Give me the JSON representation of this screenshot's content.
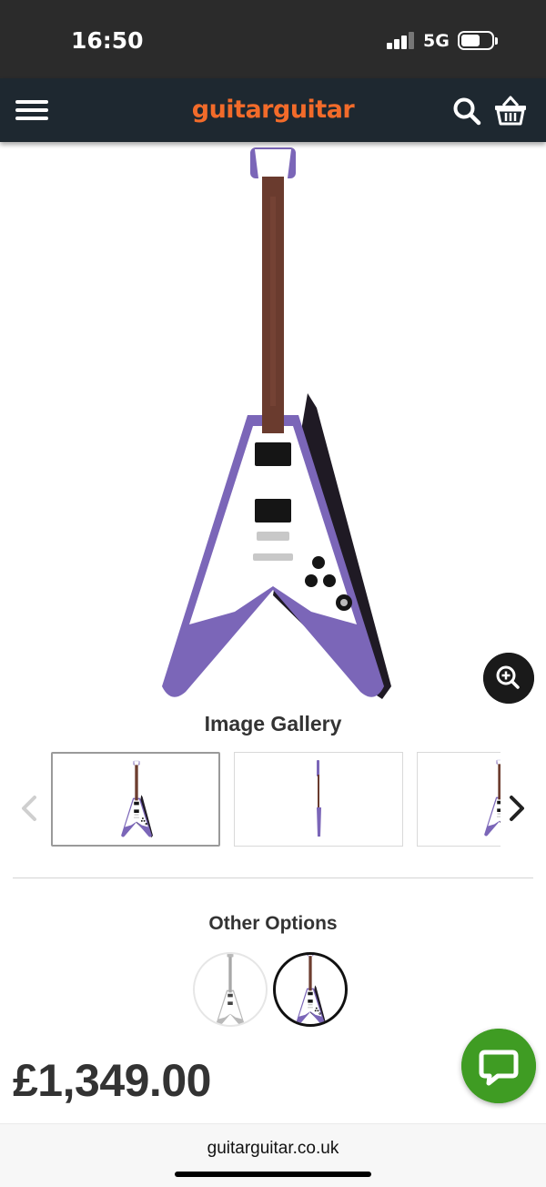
{
  "status_bar": {
    "time": "16:50",
    "network": "5G"
  },
  "header": {
    "logo_text": "guitarguitar",
    "menu_icon": "hamburger-menu-icon",
    "search_icon": "search-icon",
    "basket_icon": "basket-icon"
  },
  "product": {
    "image_zoom_icon": "zoom-in-icon",
    "price": "£1,349.00"
  },
  "gallery": {
    "title": "Image Gallery",
    "prev_icon": "chevron-left-icon",
    "next_icon": "chevron-right-icon",
    "thumbnails": [
      {
        "view": "front",
        "selected": true
      },
      {
        "view": "side",
        "selected": false
      },
      {
        "view": "angled",
        "selected": false
      }
    ]
  },
  "options": {
    "title": "Other Options",
    "swatches": [
      {
        "finish": "silver",
        "selected": false
      },
      {
        "finish": "purple",
        "selected": true
      }
    ]
  },
  "chat": {
    "icon": "chat-bubble-icon"
  },
  "browser": {
    "url": "guitarguitar.co.uk"
  },
  "colors": {
    "nav_background": "#1e2830",
    "logo_orange": "#f26b2a",
    "logo_bars": "#3fb6e4",
    "guitar_purple": "#7b66b8",
    "chat_green": "#3f9c23"
  }
}
